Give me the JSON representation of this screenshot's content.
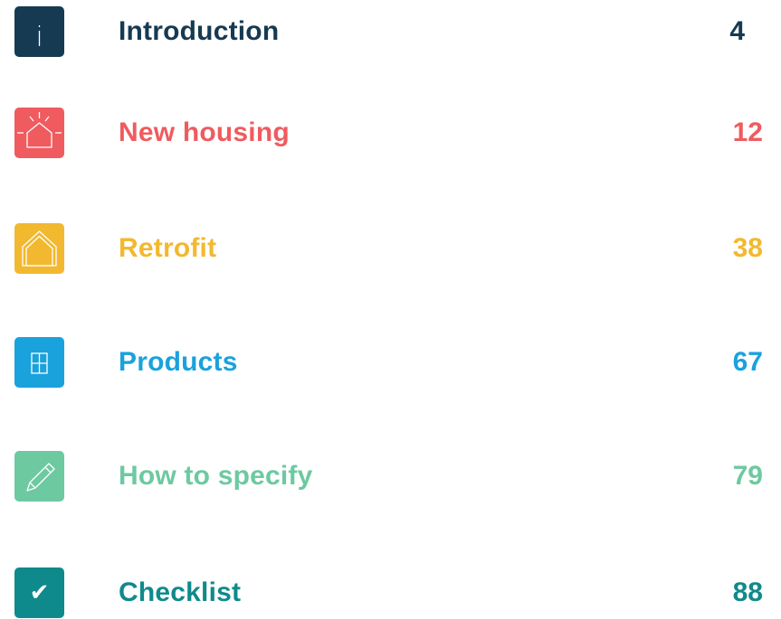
{
  "toc": {
    "items": [
      {
        "title": "Introduction",
        "page": "4",
        "color": "#163a52",
        "icon": "info-icon"
      },
      {
        "title": "New housing",
        "page": "12",
        "color": "#ef5b5f",
        "icon": "new-house-icon"
      },
      {
        "title": "Retrofit",
        "page": "38",
        "color": "#f2b82f",
        "icon": "house-outline-icon"
      },
      {
        "title": "Products",
        "page": "67",
        "color": "#1aa2dc",
        "icon": "window-icon"
      },
      {
        "title": "How to specify",
        "page": "79",
        "color": "#6dc9a0",
        "icon": "pencil-icon"
      },
      {
        "title": "Checklist",
        "page": "88",
        "color": "#0f8a8c",
        "icon": "checkmark-icon",
        "glyph": "✔"
      }
    ]
  }
}
